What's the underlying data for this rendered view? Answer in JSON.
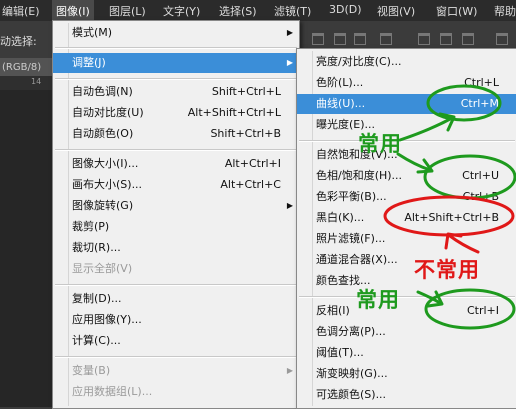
{
  "menubar": {
    "items": [
      {
        "label": "编辑(E)"
      },
      {
        "label": "图像(I)"
      },
      {
        "label": "图层(L)"
      },
      {
        "label": "文字(Y)"
      },
      {
        "label": "选择(S)"
      },
      {
        "label": "滤镜(T)"
      },
      {
        "label": "3D(D)"
      },
      {
        "label": "视图(V)"
      },
      {
        "label": "窗口(W)"
      },
      {
        "label": "帮助"
      }
    ]
  },
  "optbar": {
    "auto_select_label": "动选择:"
  },
  "document": {
    "tab_label": "(RGB/8)",
    "ruler_tick": "14"
  },
  "image_menu": {
    "items": [
      {
        "label": "模式(M)",
        "shortcut": ""
      },
      {
        "label": "调整(J)",
        "shortcut": ""
      },
      {
        "label": "自动色调(N)",
        "shortcut": "Shift+Ctrl+L"
      },
      {
        "label": "自动对比度(U)",
        "shortcut": "Alt+Shift+Ctrl+L"
      },
      {
        "label": "自动颜色(O)",
        "shortcut": "Shift+Ctrl+B"
      },
      {
        "label": "图像大小(I)...",
        "shortcut": "Alt+Ctrl+I"
      },
      {
        "label": "画布大小(S)...",
        "shortcut": "Alt+Ctrl+C"
      },
      {
        "label": "图像旋转(G)",
        "shortcut": ""
      },
      {
        "label": "裁剪(P)",
        "shortcut": ""
      },
      {
        "label": "裁切(R)...",
        "shortcut": ""
      },
      {
        "label": "显示全部(V)",
        "shortcut": ""
      },
      {
        "label": "复制(D)...",
        "shortcut": ""
      },
      {
        "label": "应用图像(Y)...",
        "shortcut": ""
      },
      {
        "label": "计算(C)...",
        "shortcut": ""
      },
      {
        "label": "变量(B)",
        "shortcut": ""
      },
      {
        "label": "应用数据组(L)...",
        "shortcut": ""
      }
    ]
  },
  "adjust_menu": {
    "items": [
      {
        "label": "亮度/对比度(C)...",
        "shortcut": ""
      },
      {
        "label": "色阶(L)...",
        "shortcut": "Ctrl+L"
      },
      {
        "label": "曲线(U)...",
        "shortcut": "Ctrl+M"
      },
      {
        "label": "曝光度(E)...",
        "shortcut": ""
      },
      {
        "label": "自然饱和度(V)...",
        "shortcut": ""
      },
      {
        "label": "色相/饱和度(H)...",
        "shortcut": "Ctrl+U"
      },
      {
        "label": "色彩平衡(B)...",
        "shortcut": "Ctrl+B"
      },
      {
        "label": "黑白(K)...",
        "shortcut": "Alt+Shift+Ctrl+B"
      },
      {
        "label": "照片滤镜(F)...",
        "shortcut": ""
      },
      {
        "label": "通道混合器(X)...",
        "shortcut": ""
      },
      {
        "label": "颜色查找...",
        "shortcut": ""
      },
      {
        "label": "反相(I)",
        "shortcut": "Ctrl+I"
      },
      {
        "label": "色调分离(P)...",
        "shortcut": ""
      },
      {
        "label": "阈值(T)...",
        "shortcut": ""
      },
      {
        "label": "渐变映射(G)...",
        "shortcut": ""
      },
      {
        "label": "可选颜色(S)...",
        "shortcut": ""
      }
    ]
  },
  "annotations": {
    "common_label_1": "常用",
    "common_label_2": "常用",
    "uncommon_label": "不常用",
    "common_color": "#1e9a1e",
    "uncommon_color": "#e01818"
  },
  "colors": {
    "highlight": "#3b8ed8",
    "menu_bg": "#f0f0f0",
    "menubar_bg": "#2b2b2b"
  }
}
